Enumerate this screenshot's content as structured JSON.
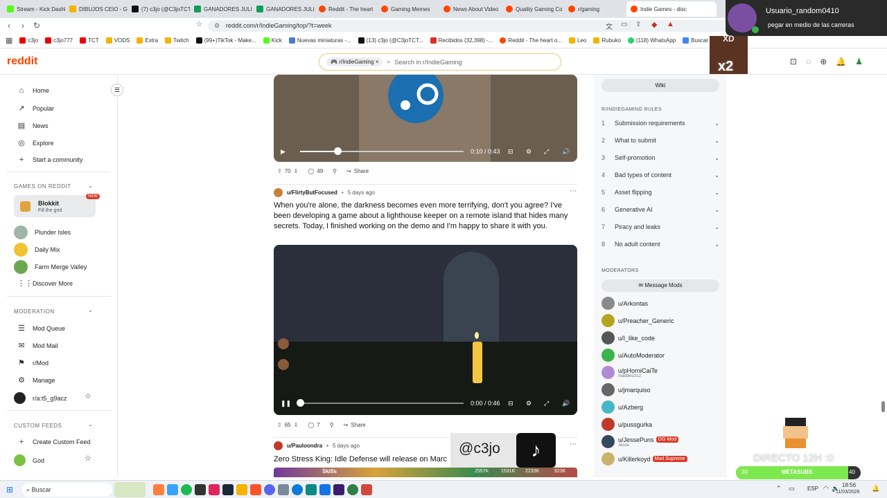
{
  "browser": {
    "tabs": [
      "Stream - Kick Dashb",
      "DIBUJOS CEIO - Go",
      "(7) c3jo (@C3joTCT",
      "GANADORES JULIO",
      "GANADORES JULIO",
      "Reddit - The heart",
      "Gaming Memes",
      "News About Video",
      "Quality Gaming Co",
      "r/gaming",
      "Indie Games - disc"
    ],
    "url": "reddit.com/r/IndieGaming/top/?t=week",
    "bookmarks": [
      "c3jo",
      "c3jo777",
      "TCT",
      "VODS",
      "Extra",
      "Twitch",
      "(99+)TikTok - Make...",
      "Kick",
      "Nuevas miniaturas -...",
      "(13) c3jo (@C3joTCT...",
      "Recibidos (32,398) -...",
      "Reddit - The heart o...",
      "Leo",
      "Rubuko",
      "(118) WhatsApp",
      "Buscar con"
    ]
  },
  "header": {
    "logo": "reddit",
    "community_chip": "r/IndieGaming",
    "search_placeholder": "Search in r/IndieGaming"
  },
  "sidebar": {
    "nav": [
      "Home",
      "Popular",
      "News",
      "Explore",
      "Start a community"
    ],
    "games_heading": "GAMES ON REDDIT",
    "blokkit": {
      "title": "Blokkit",
      "subtitle": "Fill the grid",
      "badge": "NEW"
    },
    "games": [
      "Plunder Isles",
      "Daily Mix",
      "Farm Merge Valley",
      "Discover More"
    ],
    "moderation_heading": "MODERATION",
    "moderation": [
      "Mod Queue",
      "Mod Mail",
      "r/Mod",
      "Manage",
      "r/a:t5_g9acz"
    ],
    "custom_heading": "CUSTOM FEEDS",
    "custom": [
      "Create Custom Feed",
      "God"
    ]
  },
  "posts": [
    {
      "time_label": "0:10 / 0:43",
      "progress": 0.23,
      "upvotes": "70",
      "comments": "49",
      "share": "Share"
    },
    {
      "author": "u/FlirtyButFocused",
      "age": "5 days ago",
      "text": "When you're alone, the darkness becomes even more terrifying, don't you agree? I've been developing a game about a lighthouse keeper on a remote island that hides many secrets. Today, I finished working on the demo and I'm happy to share it with you.",
      "time_label": "0:00 / 0:46",
      "progress": 0.0,
      "upvotes": "65",
      "comments": "7",
      "share": "Share"
    },
    {
      "author": "u/Pauloondra",
      "age": "5 days ago",
      "text": "Zero Stress King: Idle Defense will release on Marc"
    }
  ],
  "right_panel": {
    "wiki": "Wiki",
    "rules_heading": "R/INDIEGAMING RULES",
    "rules": [
      "Submission requirements",
      "What to submit",
      "Self-promotion",
      "Bad types of content",
      "Asset flipping",
      "Generative AI",
      "Piracy and leaks",
      "No adult content"
    ],
    "mods_heading": "MODERATORS",
    "message_mods": "Message Mods",
    "mods": [
      {
        "name": "u/Arkontas",
        "sub": "",
        "badge": "",
        "color": "#8a8a8a"
      },
      {
        "name": "u/Preacher_Generic",
        "sub": "",
        "badge": "",
        "color": "#b5a420"
      },
      {
        "name": "u/I_like_code",
        "sub": "",
        "badge": "",
        "color": "#555"
      },
      {
        "name": "u/AutoModerator",
        "sub": "",
        "badge": "",
        "color": "#3cb44b"
      },
      {
        "name": "u/pHorniCaiTe",
        "sub": "maddie1312",
        "badge": "",
        "color": "#b18ad6"
      },
      {
        "name": "u/jmarquiso",
        "sub": "",
        "badge": "",
        "color": "#666"
      },
      {
        "name": "u/Azberg",
        "sub": "",
        "badge": "",
        "color": "#47b6c8"
      },
      {
        "name": "u/pussgurka",
        "sub": "",
        "badge": "",
        "color": "#c0392b"
      },
      {
        "name": "u/JessePuns",
        "sub": "Jesse",
        "badge": "OG Mod",
        "color": "#34495e"
      },
      {
        "name": "u/Killerkoyd",
        "sub": "",
        "badge": "Mod Supreme",
        "color": "#c9b26b"
      }
    ]
  },
  "overlay": {
    "user": "Usuario_random0410",
    "message": "pegar en medio de las carreras",
    "xd": "XD",
    "x2": "x2",
    "handle": "@c3jo",
    "directo": "DIRECTO 12H :0",
    "meta_left": "30",
    "meta_label": "METASUBS",
    "meta_right": "40",
    "meta_fill": 0.9,
    "game_hud": [
      "Skills",
      "2557K",
      "1531K",
      "2233K",
      "923K"
    ]
  },
  "taskbar": {
    "search": "Buscar",
    "lang": "ESP",
    "time": "18:56",
    "date": "11/03/2026"
  }
}
